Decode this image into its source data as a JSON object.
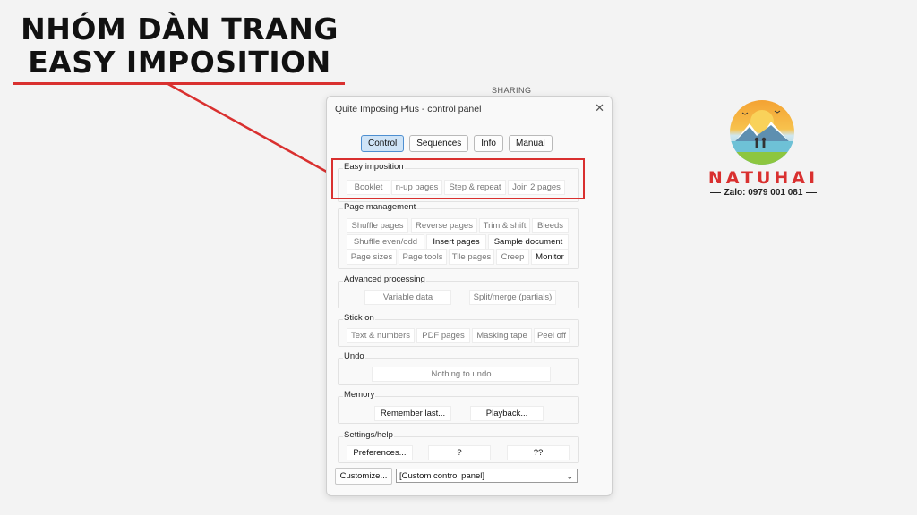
{
  "heading": {
    "line1": "NHÓM DÀN TRANG",
    "line2": "EASY IMPOSITION"
  },
  "sharing_label": "SHARING",
  "window": {
    "title": "Quite Imposing Plus - control panel",
    "close_glyph": "✕",
    "tabs": [
      {
        "label": "Control",
        "active": true
      },
      {
        "label": "Sequences",
        "active": false
      },
      {
        "label": "Info",
        "active": false
      },
      {
        "label": "Manual",
        "active": false
      }
    ],
    "groups": {
      "easy": {
        "title": "Easy imposition",
        "buttons": [
          "Booklet",
          "n-up pages",
          "Step & repeat",
          "Join 2 pages"
        ]
      },
      "page": {
        "title": "Page management",
        "buttons": [
          "Shuffle pages",
          "Reverse pages",
          "Trim & shift",
          "Bleeds",
          "Shuffle even/odd",
          "Insert pages",
          "Sample document",
          "Page sizes",
          "Page tools",
          "Tile pages",
          "Creep",
          "Monitor"
        ]
      },
      "advanced": {
        "title": "Advanced processing",
        "buttons": [
          "Variable data",
          "Split/merge (partials)"
        ]
      },
      "stick": {
        "title": "Stick on",
        "buttons": [
          "Text & numbers",
          "PDF pages",
          "Masking tape",
          "Peel off"
        ]
      },
      "undo": {
        "title": "Undo",
        "buttons": [
          "Nothing to undo"
        ]
      },
      "memory": {
        "title": "Memory",
        "buttons": [
          "Remember last...",
          "Playback..."
        ]
      },
      "settings": {
        "title": "Settings/help",
        "buttons": [
          "Preferences...",
          "?",
          "??"
        ]
      }
    },
    "customize_label": "Customize...",
    "panel_select": {
      "value": "[Custom control panel]",
      "chevron": "⌄"
    }
  },
  "logo": {
    "brand": "NATUHAI",
    "zalo": "Zalo: 0979 001 081"
  },
  "colors": {
    "accent_red": "#d9302f",
    "active_tab": "#cfe4f7",
    "brand_orange": "#f4a233"
  }
}
